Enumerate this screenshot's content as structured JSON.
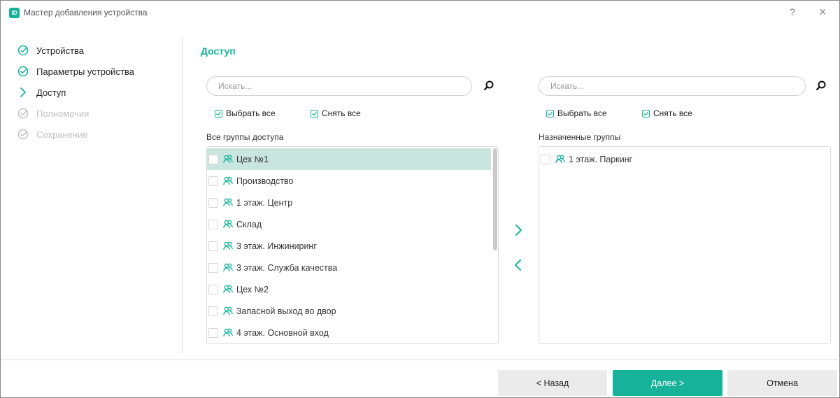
{
  "window": {
    "title": "Мастер добавления устройства",
    "logo_text": "ID",
    "help_label": "?",
    "close_label": "×"
  },
  "colors": {
    "accent": "#16b39a",
    "selected_row": "#c8e5df",
    "pending_step": "#c2c2c2"
  },
  "steps": [
    {
      "label": "Устройства",
      "state": "done",
      "icon": "check-circle-icon"
    },
    {
      "label": "Параметры устройства",
      "state": "done",
      "icon": "check-circle-icon"
    },
    {
      "label": "Доступ",
      "state": "current",
      "icon": "chevron-right-icon"
    },
    {
      "label": "Полномочия",
      "state": "pending",
      "icon": "check-circle-icon"
    },
    {
      "label": "Сохранение",
      "state": "pending",
      "icon": "check-circle-icon"
    }
  ],
  "main": {
    "section_title": "Доступ",
    "left": {
      "search_placeholder": "Искать...",
      "select_all": "Выбрать все",
      "deselect_all": "Снять все",
      "list_title": "Все группы доступа",
      "items": [
        {
          "label": "Цех №1",
          "selected": true
        },
        {
          "label": "Производство",
          "selected": false
        },
        {
          "label": "1 этаж. Центр",
          "selected": false
        },
        {
          "label": "Склад",
          "selected": false
        },
        {
          "label": "3 этаж. Инжиниринг",
          "selected": false
        },
        {
          "label": "3 этаж. Служба качества",
          "selected": false
        },
        {
          "label": "Цех №2",
          "selected": false
        },
        {
          "label": "Запасной выход во двор",
          "selected": false
        },
        {
          "label": "4 этаж. Основной вход",
          "selected": false
        }
      ]
    },
    "right": {
      "search_placeholder": "Искать...",
      "select_all": "Выбрать все",
      "deselect_all": "Снять все",
      "list_title": "Назначенные группы",
      "items": [
        {
          "label": "1 этаж. Паркинг",
          "selected": false
        }
      ]
    }
  },
  "footer": {
    "back_label": "< Назад",
    "next_label": "Далее >",
    "cancel_label": "Отмена"
  }
}
